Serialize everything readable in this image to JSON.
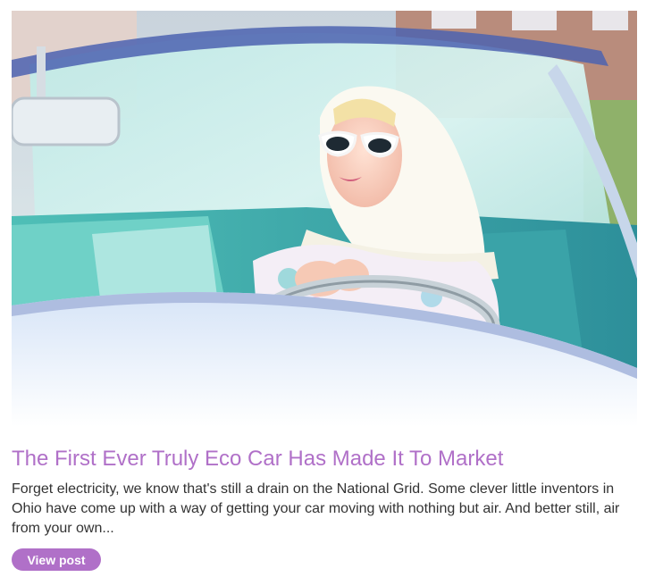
{
  "post": {
    "image_alt": "Woman in white headscarf and sunglasses driving a vintage turquoise convertible",
    "title": "The First Ever Truly Eco Car Has Made It To Market",
    "excerpt": "Forget electricity, we know that's still a drain on the National Grid. Some clever little inventors in Ohio have come up with a way of getting your car moving with nothing but air. And better still, air from your own...",
    "button_label": "View post"
  },
  "colors": {
    "accent": "#b070c8",
    "text": "#333333"
  }
}
